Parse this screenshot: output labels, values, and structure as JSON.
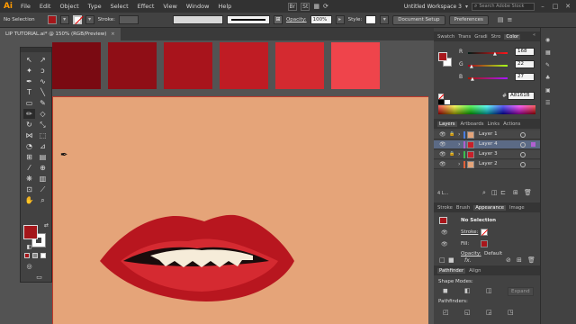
{
  "app": {
    "logo": "Ai"
  },
  "menu": [
    "File",
    "Edit",
    "Object",
    "Type",
    "Select",
    "Effect",
    "View",
    "Window",
    "Help"
  ],
  "menubar_right": {
    "br_badge": "Br",
    "st_badge": "St",
    "workspace": "Untitled Workspace 3",
    "search_placeholder": "Search Adobe Stock"
  },
  "control": {
    "selection": "No Selection",
    "stroke_label": "Stroke:",
    "opacity_label": "Opacity:",
    "opacity_value": "100%",
    "style_label": "Style:",
    "doc_setup": "Document Setup",
    "preferences": "Preferences"
  },
  "document": {
    "tab": "LIP TUTORIAL.ai* @ 150% (RGB/Preview)",
    "close": "×"
  },
  "swatches_top": [
    "#7a0a12",
    "#8f0e16",
    "#a8141c",
    "#bf1c24",
    "#d42a30",
    "#ef444b"
  ],
  "artboard": {
    "bg": "#e5a479"
  },
  "lips": {
    "outer": "#b8161f",
    "mid": "#d52a31",
    "teeth": "#f6ecd9",
    "mouth": "#1a0c0c"
  },
  "toolbar": {
    "fill_color": "#a4161a",
    "stroke_color": "#ffffff"
  },
  "color_panel": {
    "tabs": [
      "Swatch",
      "Trans",
      "Gradi",
      "Stro",
      "Color"
    ],
    "r_label": "R",
    "g_label": "G",
    "b_label": "B",
    "r": "168",
    "g": "22",
    "b": "27",
    "hex_prefix": "#",
    "hex": "A8161B"
  },
  "layers_panel": {
    "tabs": [
      "Layers",
      "Artboards",
      "Links",
      "Actions"
    ],
    "layers": [
      {
        "name": "Layer 1",
        "color": "#4a7de0",
        "thumb": "#e5a479",
        "selected": false
      },
      {
        "name": "Layer 4",
        "color": "#b060d0",
        "thumb": "#c8202a",
        "selected": true
      },
      {
        "name": "Layer 3",
        "color": "#3bbf4e",
        "thumb": "#c8202a",
        "selected": false
      },
      {
        "name": "Layer 2",
        "color": "#e0603a",
        "thumb": "#e5a479",
        "selected": false
      }
    ],
    "count": "4 L..."
  },
  "appearance_panel": {
    "tabs": [
      "Stroke",
      "Brush",
      "Appearance",
      "Image"
    ],
    "title": "No Selection",
    "stroke_label": "Stroke:",
    "fill_label": "Fill:",
    "opacity_label": "Opacity:",
    "opacity_value": "Default",
    "fx": "fx."
  },
  "pathfinder_panel": {
    "tabs": [
      "Pathfinder",
      "Align"
    ],
    "shape_modes": "Shape Modes:",
    "expand": "Expand",
    "pathfinders": "Pathfinders:"
  }
}
